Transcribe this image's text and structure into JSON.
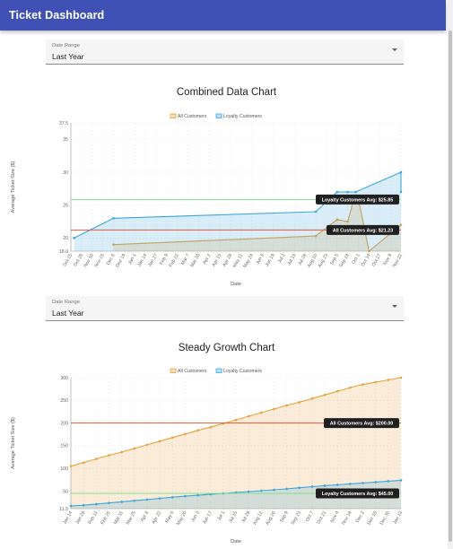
{
  "app": {
    "title": "Ticket Dashboard"
  },
  "filters": [
    {
      "label": "Date Range",
      "value": "Last Year"
    },
    {
      "label": "Date Range",
      "value": "Last Year"
    }
  ],
  "colors": {
    "appbar": "#3f51b5",
    "all_customers": "#e6a23c",
    "loyalty_customers": "#3ba6dc",
    "avg_line_red": "#e05a3a",
    "avg_line_green": "#7de08f"
  },
  "chart_data": [
    {
      "type": "area",
      "title": "Combined Data Chart",
      "xlabel": "Date",
      "ylabel": "Average Ticket Size ($)",
      "ylim": [
        18.0,
        37.5
      ],
      "yticks": [
        "18.0",
        "20",
        "25",
        "30",
        "35",
        "37.5"
      ],
      "grid": true,
      "legend": "top",
      "x_ticks": [
        "Oct 15",
        "Oct 28",
        "Nov 10",
        "Nov 23",
        "Dec 6",
        "Dec 19",
        "Jan 1",
        "Jan 14",
        "Jan 27",
        "Feb 9",
        "Feb 22",
        "Mar 7",
        "Mar 20",
        "Apr 2",
        "Apr 15",
        "Apr 28",
        "May 11",
        "May 24",
        "Jun 6",
        "Jun 19",
        "Jul 2",
        "Jul 15",
        "Jul 28",
        "Aug 10",
        "Aug 23",
        "Sep 5",
        "Sep 18",
        "Oct 1",
        "Oct 14",
        "Oct 27",
        "Nov 9",
        "Nov 22"
      ],
      "series": [
        {
          "name": "All Customers",
          "color": "#e6a23c",
          "points": [
            [
              "Dec 6",
              19.0
            ],
            [
              "Aug 10",
              20.3
            ],
            [
              "Sep 5",
              22.8
            ],
            [
              "Sep 18",
              22.5
            ],
            [
              "Sep 25",
              25.5
            ],
            [
              "Oct 1",
              26.0
            ],
            [
              "Oct 8",
              22.0
            ],
            [
              "Oct 14",
              18.0
            ]
          ]
        },
        {
          "name": "Loyalty Customers",
          "color": "#3ba6dc",
          "points": [
            [
              "Dec 6",
              23.0
            ],
            [
              "Aug 10",
              24.0
            ],
            [
              "Sep 5",
              27.0
            ],
            [
              "Sep 18",
              27.0
            ],
            [
              "Sep 28",
              27.0
            ],
            [
              "Oct 5",
              30.0
            ],
            [
              "Oct 11",
              27.0
            ],
            [
              "Oct 19",
              20.0
            ]
          ]
        }
      ],
      "annotations": [
        {
          "text": "Loyalty Customers Avg: $25.85",
          "y": 25.85,
          "color": "#7de08f"
        },
        {
          "text": "All Customers Avg: $21.23",
          "y": 21.23,
          "color": "#e05a3a"
        }
      ]
    },
    {
      "type": "area",
      "title": "Steady Growth Chart",
      "xlabel": "Date",
      "ylabel": "Average Ticket Size ($)",
      "ylim": [
        11.5,
        300
      ],
      "yticks": [
        "11.5",
        "50",
        "100",
        "150",
        "200",
        "250",
        "300"
      ],
      "grid": true,
      "legend": "top",
      "x_ticks": [
        "Jan 14",
        "Jan 28",
        "Feb 11",
        "Feb 25",
        "Mar 11",
        "Mar 25",
        "Apr 8",
        "Apr 22",
        "May 6",
        "May 20",
        "Jun 3",
        "Jun 17",
        "Jul 1",
        "Jul 15",
        "Jul 29",
        "Aug 12",
        "Aug 26",
        "Sep 9",
        "Sep 23",
        "Oct 7",
        "Oct 21",
        "Nov 4",
        "Nov 18",
        "Dec 2",
        "Dec 16",
        "Dec 30",
        "Jan 13"
      ],
      "series": [
        {
          "name": "All Customers",
          "color": "#e6a23c",
          "values": [
            105,
            113,
            121,
            129,
            136,
            144,
            152,
            160,
            168,
            176,
            184,
            191,
            199,
            207,
            215,
            223,
            231,
            239,
            246,
            254,
            262,
            270,
            278,
            285,
            290,
            295,
            300
          ]
        },
        {
          "name": "Loyalty Customers",
          "color": "#3ba6dc",
          "values": [
            17.5,
            19,
            21.5,
            24,
            26.5,
            29,
            31.5,
            34,
            36.5,
            39,
            41,
            43,
            45,
            47,
            49,
            51,
            53,
            55,
            57.5,
            60,
            62,
            64,
            66,
            68,
            70,
            72,
            74
          ]
        }
      ],
      "annotations": [
        {
          "text": "All Customers Avg: $200.00",
          "y": 200.0,
          "color": "#e05a3a"
        },
        {
          "text": "Loyalty Customers Avg: $45.00",
          "y": 45.0,
          "color": "#7de08f"
        }
      ]
    }
  ]
}
